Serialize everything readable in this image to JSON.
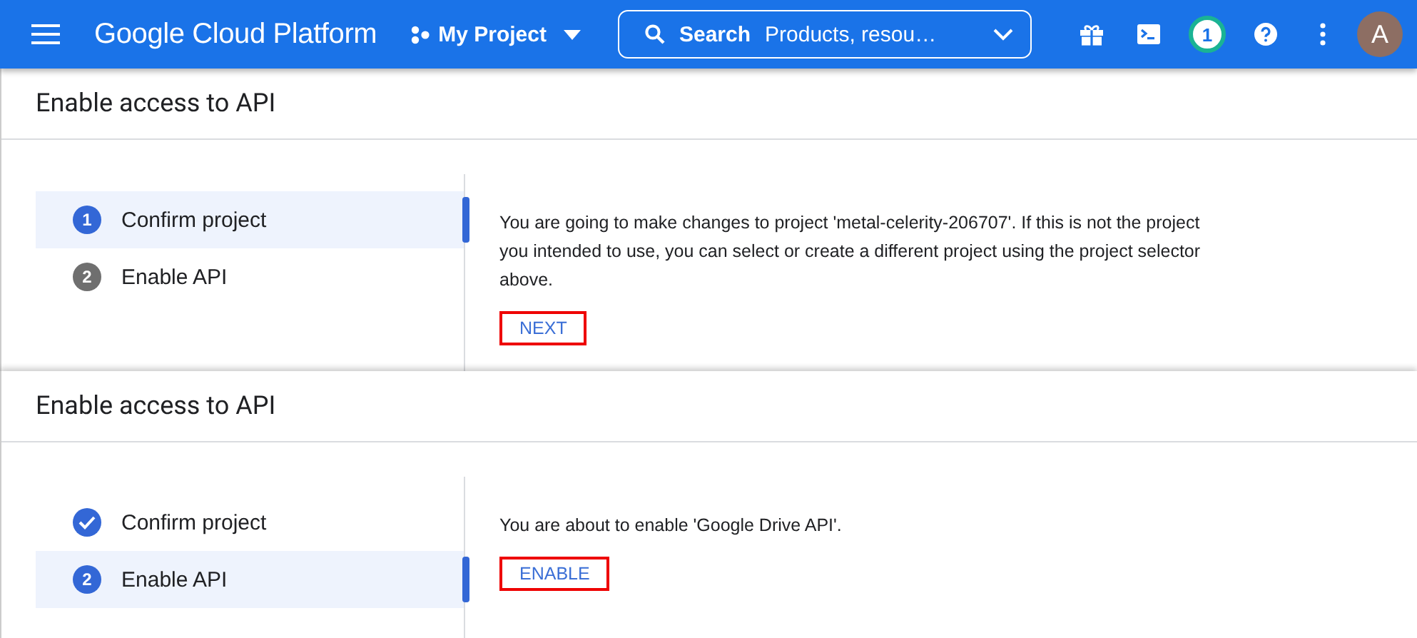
{
  "header": {
    "brand": "Google Cloud Platform",
    "project": "My Project",
    "search": {
      "label": "Search",
      "placeholder": "Products, resou…"
    },
    "notification_count": "1",
    "avatar": "A"
  },
  "panels": [
    {
      "title": "Enable access to API",
      "steps": [
        {
          "number": "1",
          "label": "Confirm project",
          "selected": true,
          "done": false
        },
        {
          "number": "2",
          "label": "Enable API",
          "selected": false,
          "done": false
        }
      ],
      "message": "You are going to make changes to project 'metal-celerity-206707'. If this is not the project you intended to use, you can select or create a different project using the project selector above.",
      "button": {
        "label": "NEXT",
        "highlighted": true
      }
    },
    {
      "title": "Enable access to API",
      "steps": [
        {
          "label": "Confirm project",
          "selected": false,
          "done": true
        },
        {
          "number": "2",
          "label": "Enable API",
          "selected": true,
          "done": false
        }
      ],
      "message": "You are about to enable 'Google Drive API'.",
      "button": {
        "label": "ENABLE",
        "highlighted": true
      }
    }
  ]
}
